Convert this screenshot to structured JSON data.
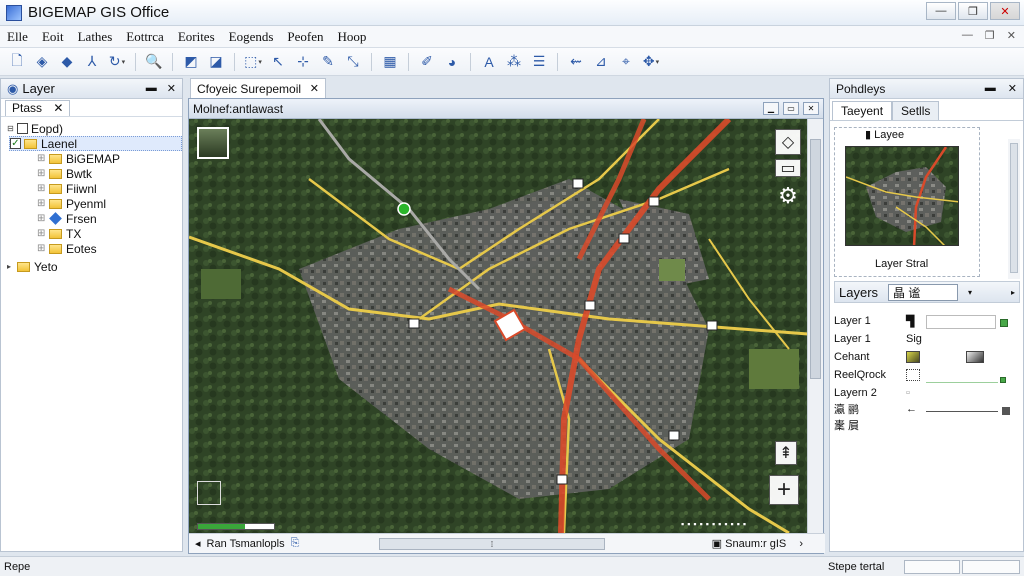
{
  "window": {
    "title": "BIGEMAP GIS Office",
    "minimize": "—",
    "maximize": "❐",
    "close": "✕"
  },
  "menu": [
    "Elle",
    "Eoit",
    "Lathes",
    "Eottrca",
    "Eorites",
    "Eogends",
    "Peofen",
    "Hoop"
  ],
  "mdi": {
    "min": "—",
    "restore": "❐",
    "close": "✕"
  },
  "left_panel": {
    "title": "Layer",
    "pin": "▬",
    "close": "✕",
    "tab": "Ptass",
    "tab_close": "✕",
    "tree": [
      {
        "label": "Eopd)"
      },
      {
        "label": "Laenel",
        "checked": "✓"
      },
      {
        "label": "BiGEMAP"
      },
      {
        "label": "Bwtk"
      },
      {
        "label": "Fiiwnl"
      },
      {
        "label": "Pyenml"
      },
      {
        "label": "Frsen"
      },
      {
        "label": "TX"
      },
      {
        "label": "Eotes"
      },
      {
        "label": "Yeto"
      }
    ]
  },
  "doc": {
    "tab_title": "Cfoyeic Surepemoil",
    "tab_close": "✕",
    "window_title": "Molnef:antlawast",
    "map_controls": {
      "locate": "◇",
      "layers": "▭",
      "settings": "⚙",
      "north": "⇞",
      "zoom_in": "+"
    },
    "progress": 0.62,
    "sheet_tab": "Ran  Tsmanlopls",
    "scroll_glyph": "⁞",
    "status_right": "Snaum:r gIS",
    "scroll_right": "›"
  },
  "right_panel": {
    "title": "Pohdleys",
    "pin": "▬",
    "close": "✕",
    "tabs": [
      "Taeyent",
      "Setlls"
    ],
    "overview_label": "Layee",
    "overview_caption": "Layer Stral",
    "layers_title": "Layers",
    "layers_select": "晶 谧",
    "rows": [
      {
        "name": "Layer 1"
      },
      {
        "name": "Layer 1",
        "value": "Sig"
      },
      {
        "name": "Cehant"
      },
      {
        "name": "ReelQrock"
      },
      {
        "name": "Layern 2"
      },
      {
        "name": "瀛 鹂"
      },
      {
        "name": "㯻 屓"
      }
    ]
  },
  "status": {
    "left": "Repe",
    "right": "Stepe tertal"
  },
  "colors": {
    "accent": "#2d5aa8",
    "road_major": "#d94a2a",
    "road_minor": "#e6c84a",
    "green_marker": "#2bb52b"
  }
}
